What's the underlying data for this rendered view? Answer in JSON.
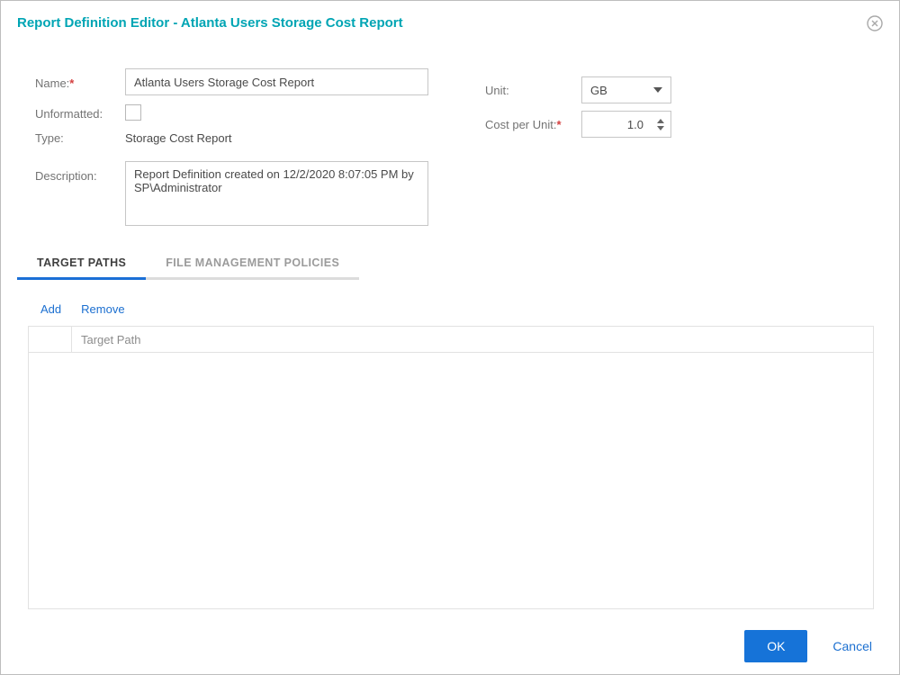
{
  "dialog": {
    "title": "Report Definition Editor - Atlanta Users Storage Cost Report"
  },
  "form": {
    "name_label": "Name:",
    "name_required": "*",
    "name_value": "Atlanta Users Storage Cost Report",
    "unformatted_label": "Unformatted:",
    "type_label": "Type:",
    "type_value": "Storage Cost Report",
    "description_label": "Description:",
    "description_value": "Report Definition created on 12/2/2020 8:07:05 PM by SP\\Administrator",
    "unit_label": "Unit:",
    "unit_value": "GB",
    "cost_label": "Cost per Unit:",
    "cost_required": "*",
    "cost_value": "1.0"
  },
  "tabs": [
    {
      "label": "TARGET PATHS",
      "active": true
    },
    {
      "label": "FILE MANAGEMENT POLICIES",
      "active": false
    }
  ],
  "toolbar": {
    "add_label": "Add",
    "remove_label": "Remove"
  },
  "table": {
    "columns": [
      "",
      "Target Path"
    ],
    "rows": []
  },
  "footer": {
    "ok_label": "OK",
    "cancel_label": "Cancel"
  },
  "colors": {
    "title_teal": "#00a5b4",
    "accent_blue": "#1b6fd0",
    "ok_button_blue": "#1673d8",
    "required_red": "#d43f3f"
  }
}
